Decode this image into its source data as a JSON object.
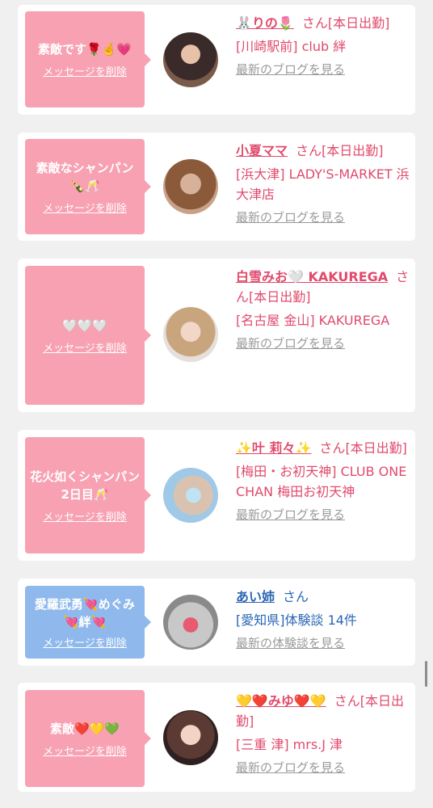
{
  "delete_label": "メッセージを削除",
  "san_label": "さん",
  "entries": [
    {
      "message": "素敵です🌹🤞💗",
      "name": "🐰りの🌷",
      "status": "[本日出勤]",
      "shop": "[川崎駅前] club 絆",
      "link": "最新のブログを見る",
      "bubble_color": "#f7a1b2"
    },
    {
      "message": "素敵なシャンパン🍾🥂",
      "name": "小夏ママ",
      "status": "[本日出勤]",
      "shop": "[浜大津] LADY'S-MARKET 浜大津店",
      "link": "最新のブログを見る",
      "bubble_color": "#f7a1b2"
    },
    {
      "message": "🤍🤍🤍",
      "name": "白雪みお🤍 KAKUREGA",
      "status": "[本日出勤]",
      "shop": "[名古屋 金山] KAKUREGA",
      "link": "最新のブログを見る",
      "bubble_color": "#f7a1b2"
    },
    {
      "message": "花火如くシャンパン2日目🥂",
      "name": "✨叶 莉々✨",
      "status": "[本日出勤]",
      "shop": "[梅田・お初天神] CLUB ONE CHAN 梅田お初天神",
      "link": "最新のブログを見る",
      "bubble_color": "#f7a1b2"
    },
    {
      "message": "愛羅武勇💘めぐみ💘絆💘",
      "name": "あい姉",
      "status": "",
      "shop": "[愛知県]体験談 14件",
      "link": "最新の体験談を見る",
      "bubble_color": "#8fb9ec"
    },
    {
      "message": "素敵❤️💛💚",
      "name": "💛❤️みゆ❤️💛",
      "status": "[本日出勤]",
      "shop": "[三重 津] mrs.J 津",
      "link": "最新のブログを見る",
      "bubble_color": "#f7a1b2"
    }
  ]
}
